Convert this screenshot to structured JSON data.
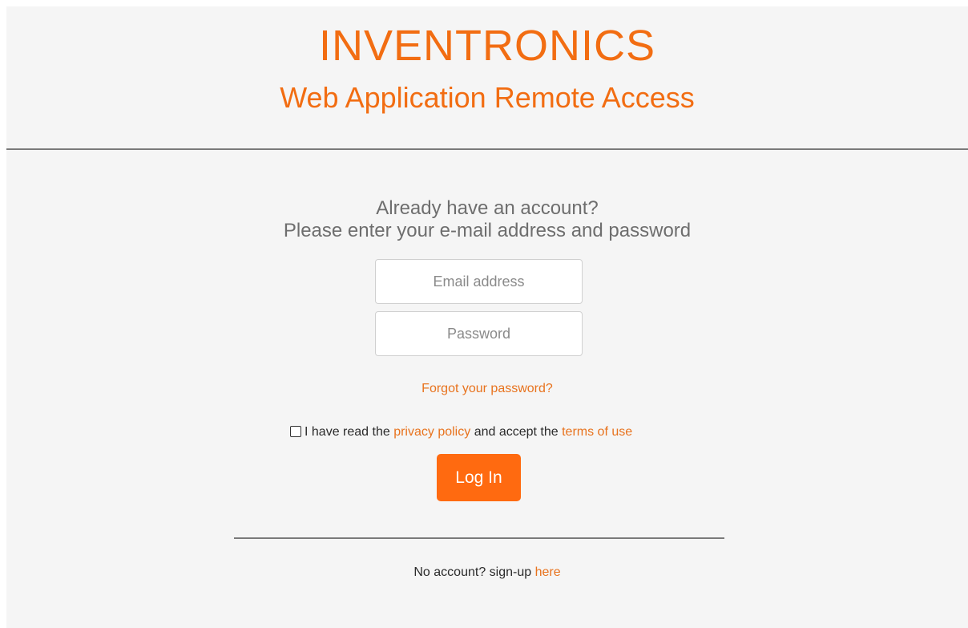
{
  "header": {
    "brand": "INVENTRONICS",
    "subtitle": "Web Application Remote Access"
  },
  "login": {
    "prompt_line1": "Already have an account?",
    "prompt_line2": "Please enter your e-mail address and password",
    "email_placeholder": "Email address",
    "email_value": "",
    "password_placeholder": "Password",
    "password_value": "",
    "forgot_link": "Forgot your password?",
    "consent": {
      "checked": false,
      "prefix": "I have read the",
      "privacy_link": "privacy policy",
      "middle": "and accept the",
      "terms_link": "terms of use"
    },
    "submit_label": "Log In"
  },
  "signup": {
    "text": "No account? sign-up",
    "link": "here"
  },
  "colors": {
    "accent": "#f26d12",
    "button": "#ff6a10",
    "link": "#e8731e",
    "background": "#f5f5f5"
  }
}
